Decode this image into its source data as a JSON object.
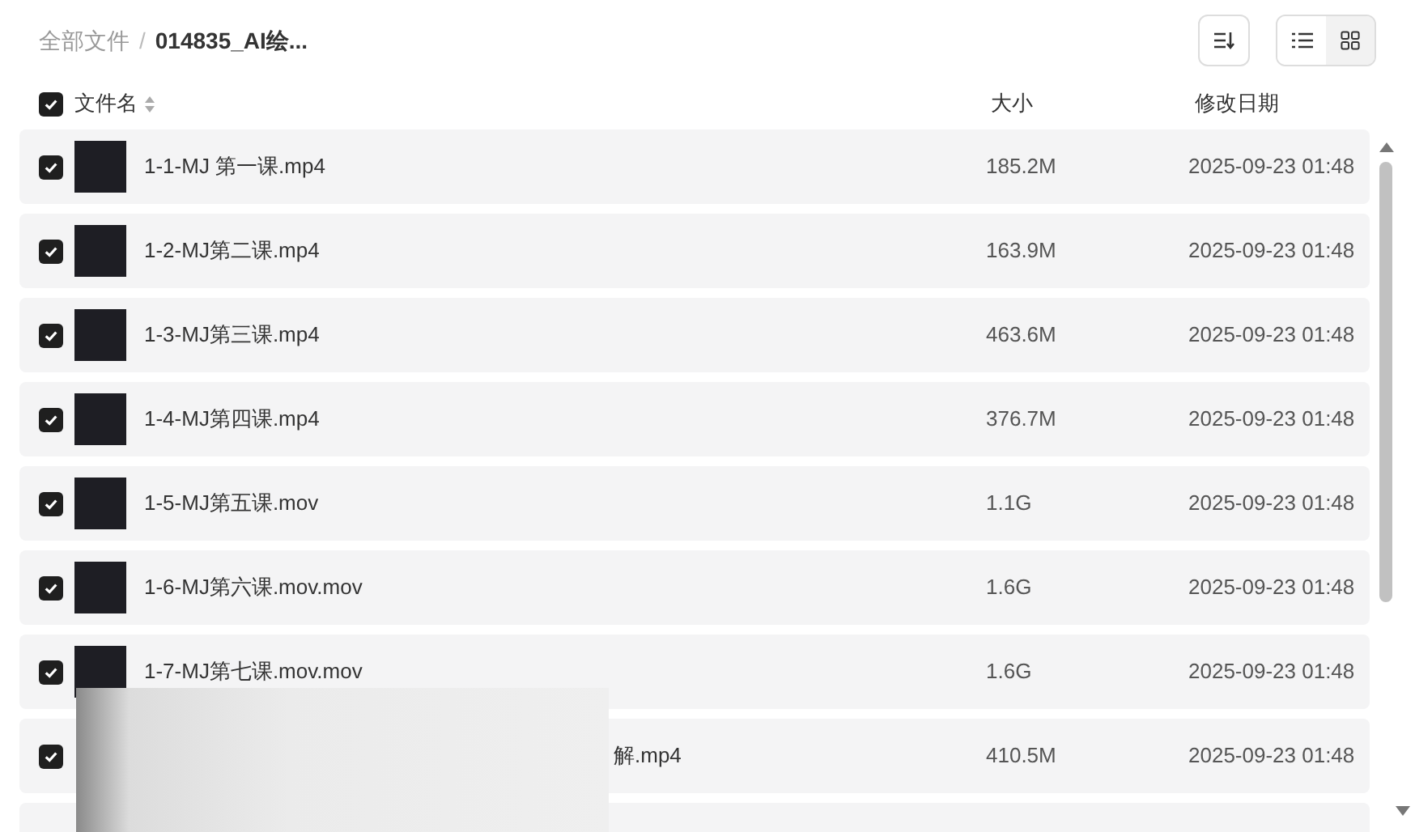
{
  "breadcrumb": {
    "root": "全部文件",
    "separator": "/",
    "current": "014835_AI绘..."
  },
  "view_toggle": [
    {
      "kind": "list",
      "selected": true
    },
    {
      "kind": "grid",
      "selected": false
    }
  ],
  "header": {
    "checked": true,
    "columns": [
      "文件名",
      "大小",
      "修改日期"
    ]
  },
  "rows": [
    {
      "name": "1-1-MJ 第一课.mp4",
      "size": "185.2M",
      "date": "2025-09-23 01:48",
      "checked": true,
      "obscured": false
    },
    {
      "name": "1-2-MJ第二课.mp4",
      "size": "163.9M",
      "date": "2025-09-23 01:48",
      "checked": true,
      "obscured": false
    },
    {
      "name": "1-3-MJ第三课.mp4",
      "size": "463.6M",
      "date": "2025-09-23 01:48",
      "checked": true,
      "obscured": false
    },
    {
      "name": "1-4-MJ第四课.mp4",
      "size": "376.7M",
      "date": "2025-09-23 01:48",
      "checked": true,
      "obscured": false
    },
    {
      "name": "1-5-MJ第五课.mov",
      "size": "1.1G",
      "date": "2025-09-23 01:48",
      "checked": true,
      "obscured": false
    },
    {
      "name": "1-6-MJ第六课.mov.mov",
      "size": "1.6G",
      "date": "2025-09-23 01:48",
      "checked": true,
      "obscured": false
    },
    {
      "name": "1-7-MJ第七课.mov.mov",
      "size": "1.6G",
      "date": "2025-09-23 01:48",
      "checked": true,
      "obscured": false
    },
    {
      "name": "解.mp4",
      "size": "410.5M",
      "date": "2025-09-23 01:48",
      "checked": true,
      "obscured": true
    }
  ]
}
